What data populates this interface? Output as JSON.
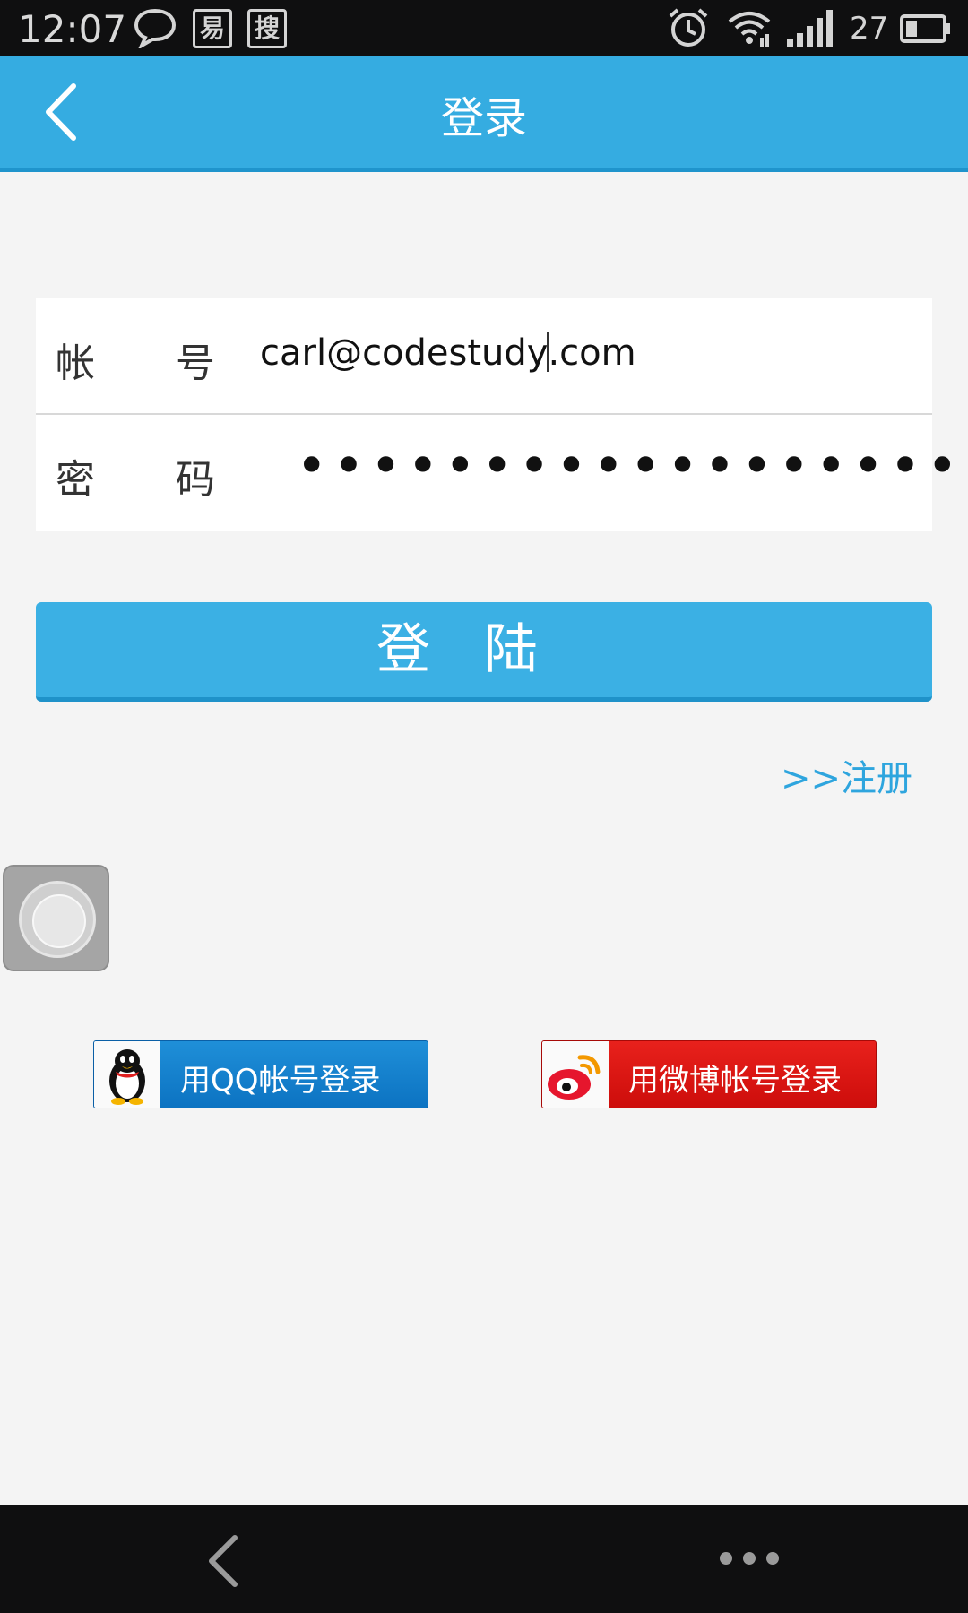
{
  "status_bar": {
    "time": "12:07",
    "icons": [
      "chat-bubble-icon",
      "yi-app-icon",
      "sou-app-icon",
      "alarm-icon",
      "wifi-icon",
      "signal-icon",
      "battery-icon"
    ],
    "app_glyph_1": "易",
    "app_glyph_2": "搜",
    "battery": "27"
  },
  "header": {
    "title": "登录",
    "color": "#35ace1"
  },
  "form": {
    "account_label_1": "帐",
    "account_label_2": "号",
    "account_value_start": "carl@codestudy",
    "account_value_end": ".com",
    "password_label_1": "密",
    "password_label_2": "码",
    "password_mask": "•••••••••••••••••••"
  },
  "login_button": {
    "label": "登陆",
    "color": "#3bb0e4"
  },
  "register_link": {
    "label": ">>注册"
  },
  "social": {
    "qq_label": "用QQ帐号登录",
    "weibo_label": "用微博帐号登录",
    "qq_color": "#0c73c2",
    "weibo_color": "#cd0d0b"
  },
  "nav_bar": {
    "icons": [
      "back-icon",
      "more-icon"
    ]
  }
}
